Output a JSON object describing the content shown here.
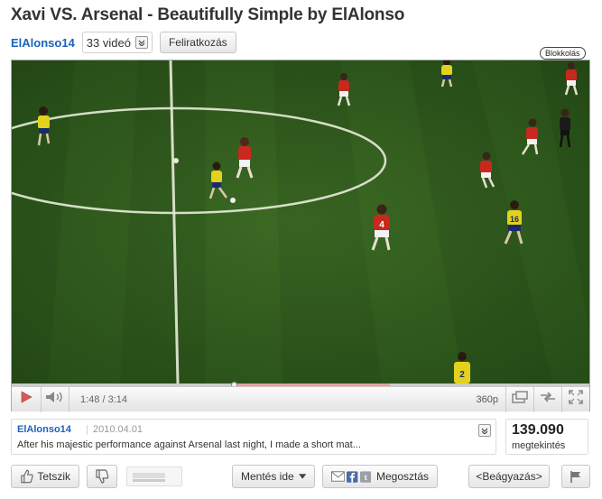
{
  "page": {
    "title": "Xavi VS. Arsenal - Beautifully Simple by ElAlonso"
  },
  "channel": {
    "name": "ElAlonso14",
    "video_count": "33 videó",
    "subscribe_label": "Feliratkozás"
  },
  "player": {
    "block_label": "Blokkolás",
    "time": "1:48 / 3:14",
    "quality": "360p",
    "progress_played": 0.385,
    "progress_buffered": 0.655,
    "controls": [
      "play-icon",
      "volume-icon",
      "widescreen-icon",
      "popout-icon",
      "fullscreen-icon"
    ],
    "jersey_numbers": [
      "4",
      "16",
      "2"
    ]
  },
  "info": {
    "author": "ElAlonso14",
    "date": "2010.04.01",
    "description": "After his majestic performance against Arsenal last night, I made a short mat..."
  },
  "views": {
    "count": "139.090",
    "label": "megtekintés"
  },
  "actions": {
    "like_label": "Tetszik",
    "save_label": "Mentés ide",
    "share_label": "Megosztás",
    "embed_label": "<Beágyazás>"
  },
  "colors": {
    "link": "#1c62b9",
    "progress": "#d21f1f",
    "pitch": "#2e5a1e"
  }
}
